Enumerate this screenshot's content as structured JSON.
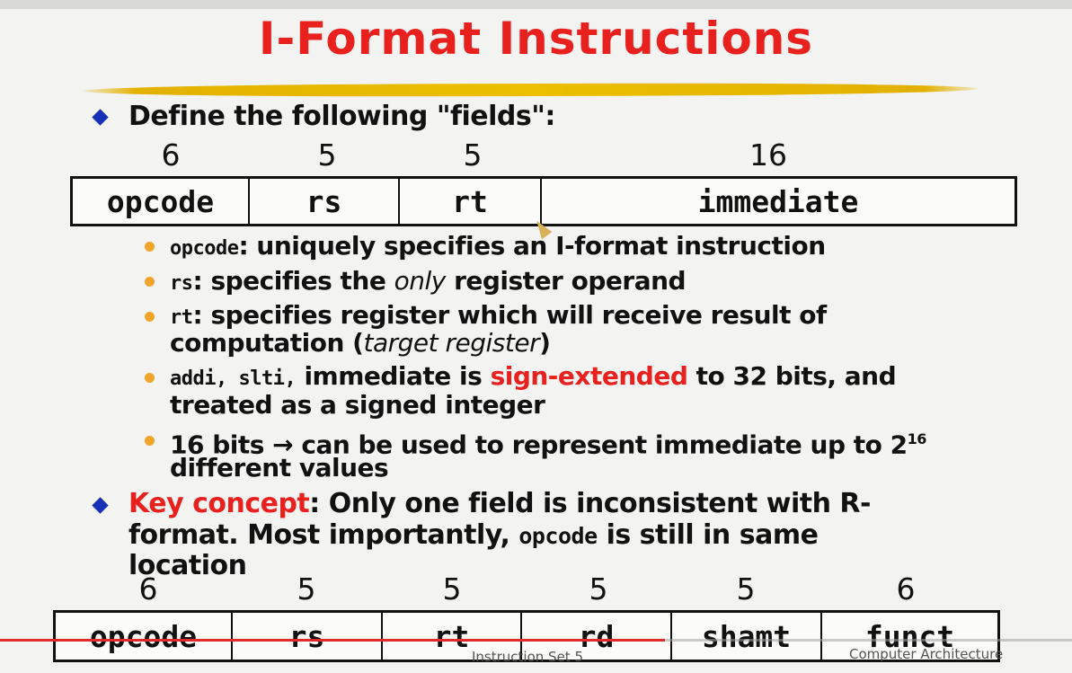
{
  "title": "I-Format Instructions",
  "intro": "Define the following \"fields\":",
  "iformat": {
    "bits": [
      "6",
      "5",
      "5",
      "16"
    ],
    "fields": [
      "opcode",
      "rs",
      "rt",
      "immediate"
    ]
  },
  "bullets": {
    "b1_code": "opcode",
    "b1_text": ": uniquely specifies an I-format instruction",
    "b2_code": "rs",
    "b2_text_a": ": specifies the ",
    "b2_text_em": "only",
    "b2_text_b": " register operand",
    "b3_code": "rt",
    "b3_text": ": specifies register which will receive result of",
    "b3_cont_a": "computation (",
    "b3_cont_em": "target register",
    "b3_cont_b": ")",
    "b4_code": "addi, slti,",
    "b4_text_a": " immediate is ",
    "b4_red": "sign-extended",
    "b4_text_b": " to 32 bits, and",
    "b4_cont": "treated as a signed integer",
    "b5_text": "16 bits → can be used to represent immediate up to 2",
    "b5_sup": "16",
    "b5_cont": "different values"
  },
  "key": {
    "label": "Key concept",
    "text_a": ": Only one field is inconsistent with R-",
    "line2_a": "format.  Most importantly, ",
    "line2_code": "opcode",
    "line2_b": " is still in same",
    "line3": "location"
  },
  "rformat": {
    "bits": [
      "6",
      "5",
      "5",
      "5",
      "5",
      "6"
    ],
    "fields": [
      "opcode",
      "rs",
      "rt",
      "rd",
      "shamt",
      "funct"
    ]
  },
  "footer": {
    "center": "Instruction Set 5",
    "right": "Computer Architecture"
  },
  "video_progress_fraction": 0.62,
  "colors": {
    "title": "#e8211f",
    "bullet_diamond": "#1531b8",
    "sub_bullet_dot": "#f0a52a",
    "highlight": "#e8211f",
    "brush_underline": "#ebc000"
  }
}
